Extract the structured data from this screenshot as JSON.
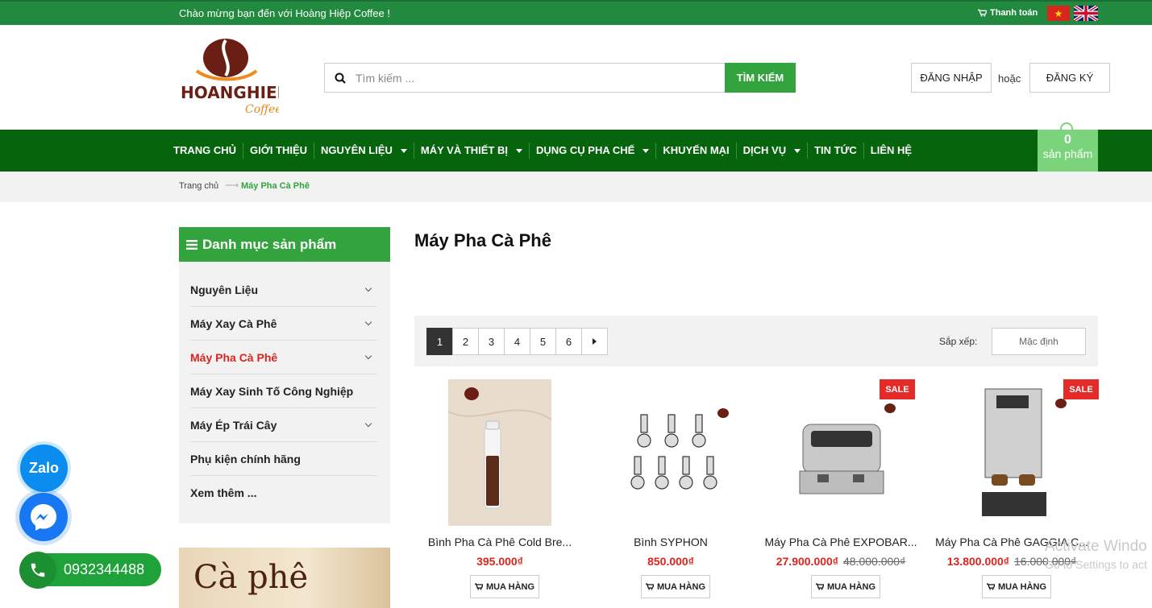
{
  "topbar": {
    "welcome": "Chào mừng bạn đến với Hoàng Hiệp Coffee !",
    "checkout": "Thanh toán",
    "flag_vn_icon": "vietnam-flag-icon",
    "flag_uk_icon": "uk-flag-icon"
  },
  "header": {
    "logo_text_main": "HOANGHIEP",
    "logo_text_sub": "Coffee",
    "search_placeholder": "Tìm kiếm ...",
    "search_button": "TÌM KIẾM",
    "login": "ĐĂNG NHẬP",
    "or": "hoặc",
    "register": "ĐĂNG KÝ"
  },
  "nav": {
    "items": [
      {
        "label": "TRANG CHỦ"
      },
      {
        "label": "GIỚI THIỆU"
      },
      {
        "label": "NGUYÊN LIỆU"
      },
      {
        "label": "MÁY VÀ THIẾT BỊ"
      },
      {
        "label": "DỤNG CỤ PHA CHẾ"
      },
      {
        "label": "KHUYẾN MẠI"
      },
      {
        "label": "DỊCH VỤ"
      },
      {
        "label": "TIN TỨC"
      },
      {
        "label": "LIÊN HỆ"
      }
    ],
    "cart_count": "0",
    "cart_label": "sản phẩm"
  },
  "breadcrumb": {
    "home": "Trang chủ",
    "arrow": "⟶",
    "current": "Máy Pha Cà Phê"
  },
  "sidebar": {
    "title": "Danh mục sản phẩm",
    "items": [
      {
        "label": "Nguyên Liệu"
      },
      {
        "label": "Máy Xay Cà Phê"
      },
      {
        "label": "Máy Pha Cà Phê"
      },
      {
        "label": "Máy Xay Sinh Tố Công Nghiệp"
      },
      {
        "label": "Máy Ép Trái Cây"
      },
      {
        "label": "Phụ kiện chính hãng"
      },
      {
        "label": "Xem thêm ..."
      }
    ],
    "promo_text": "Cà phê"
  },
  "main": {
    "title": "Máy Pha Cà Phê",
    "pages": [
      "1",
      "2",
      "3",
      "4",
      "5",
      "6"
    ],
    "sort_label": "Sắp xếp:",
    "sort_value": "Mặc định",
    "sale_badge": "SALE",
    "buy_label": "MUA HÀNG",
    "products": [
      {
        "name": "Bình Pha Cà Phê Cold Bre...",
        "price": "395.000₫",
        "old_price": ""
      },
      {
        "name": "Bình SYPHON",
        "price": "850.000₫",
        "old_price": ""
      },
      {
        "name": "Máy Pha Cà Phê EXPOBAR...",
        "price": "27.900.000₫",
        "old_price": "48.000.000₫"
      },
      {
        "name": "Máy Pha Cà Phê GAGGIA C...",
        "price": "13.800.000₫",
        "old_price": "16.000.000₫"
      }
    ]
  },
  "contact": {
    "zalo": "Zalo",
    "phone": "0932344488"
  },
  "watermark": {
    "line1": "Activate Windo",
    "line2": "Go to Settings to act"
  },
  "colors": {
    "topbar": "#218a3f",
    "nav": "#05640c",
    "accent": "#33a33d",
    "price": "#d9251d"
  }
}
